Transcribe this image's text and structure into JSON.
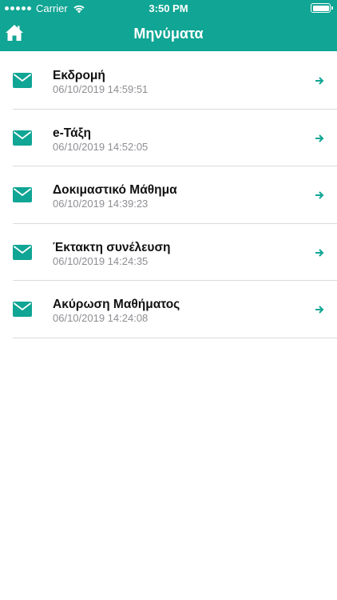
{
  "status_bar": {
    "carrier": "Carrier",
    "time": "3:50 PM"
  },
  "header": {
    "title": "Μηνύματα",
    "home_icon": "home-icon",
    "background": "#10a594"
  },
  "messages": [
    {
      "subject": "Εκδρομή",
      "date": "06/10/2019 14:59:51"
    },
    {
      "subject": "e-Τάξη",
      "date": "06/10/2019 14:52:05"
    },
    {
      "subject": "Δοκιμαστικό Μάθημα",
      "date": "06/10/2019 14:39:23"
    },
    {
      "subject": "Έκτακτη συνέλευση",
      "date": "06/10/2019 14:24:35"
    },
    {
      "subject": "Ακύρωση Μαθήματος",
      "date": "06/10/2019 14:24:08"
    }
  ],
  "colors": {
    "accent": "#10a594",
    "date_text": "#8e8e93"
  }
}
